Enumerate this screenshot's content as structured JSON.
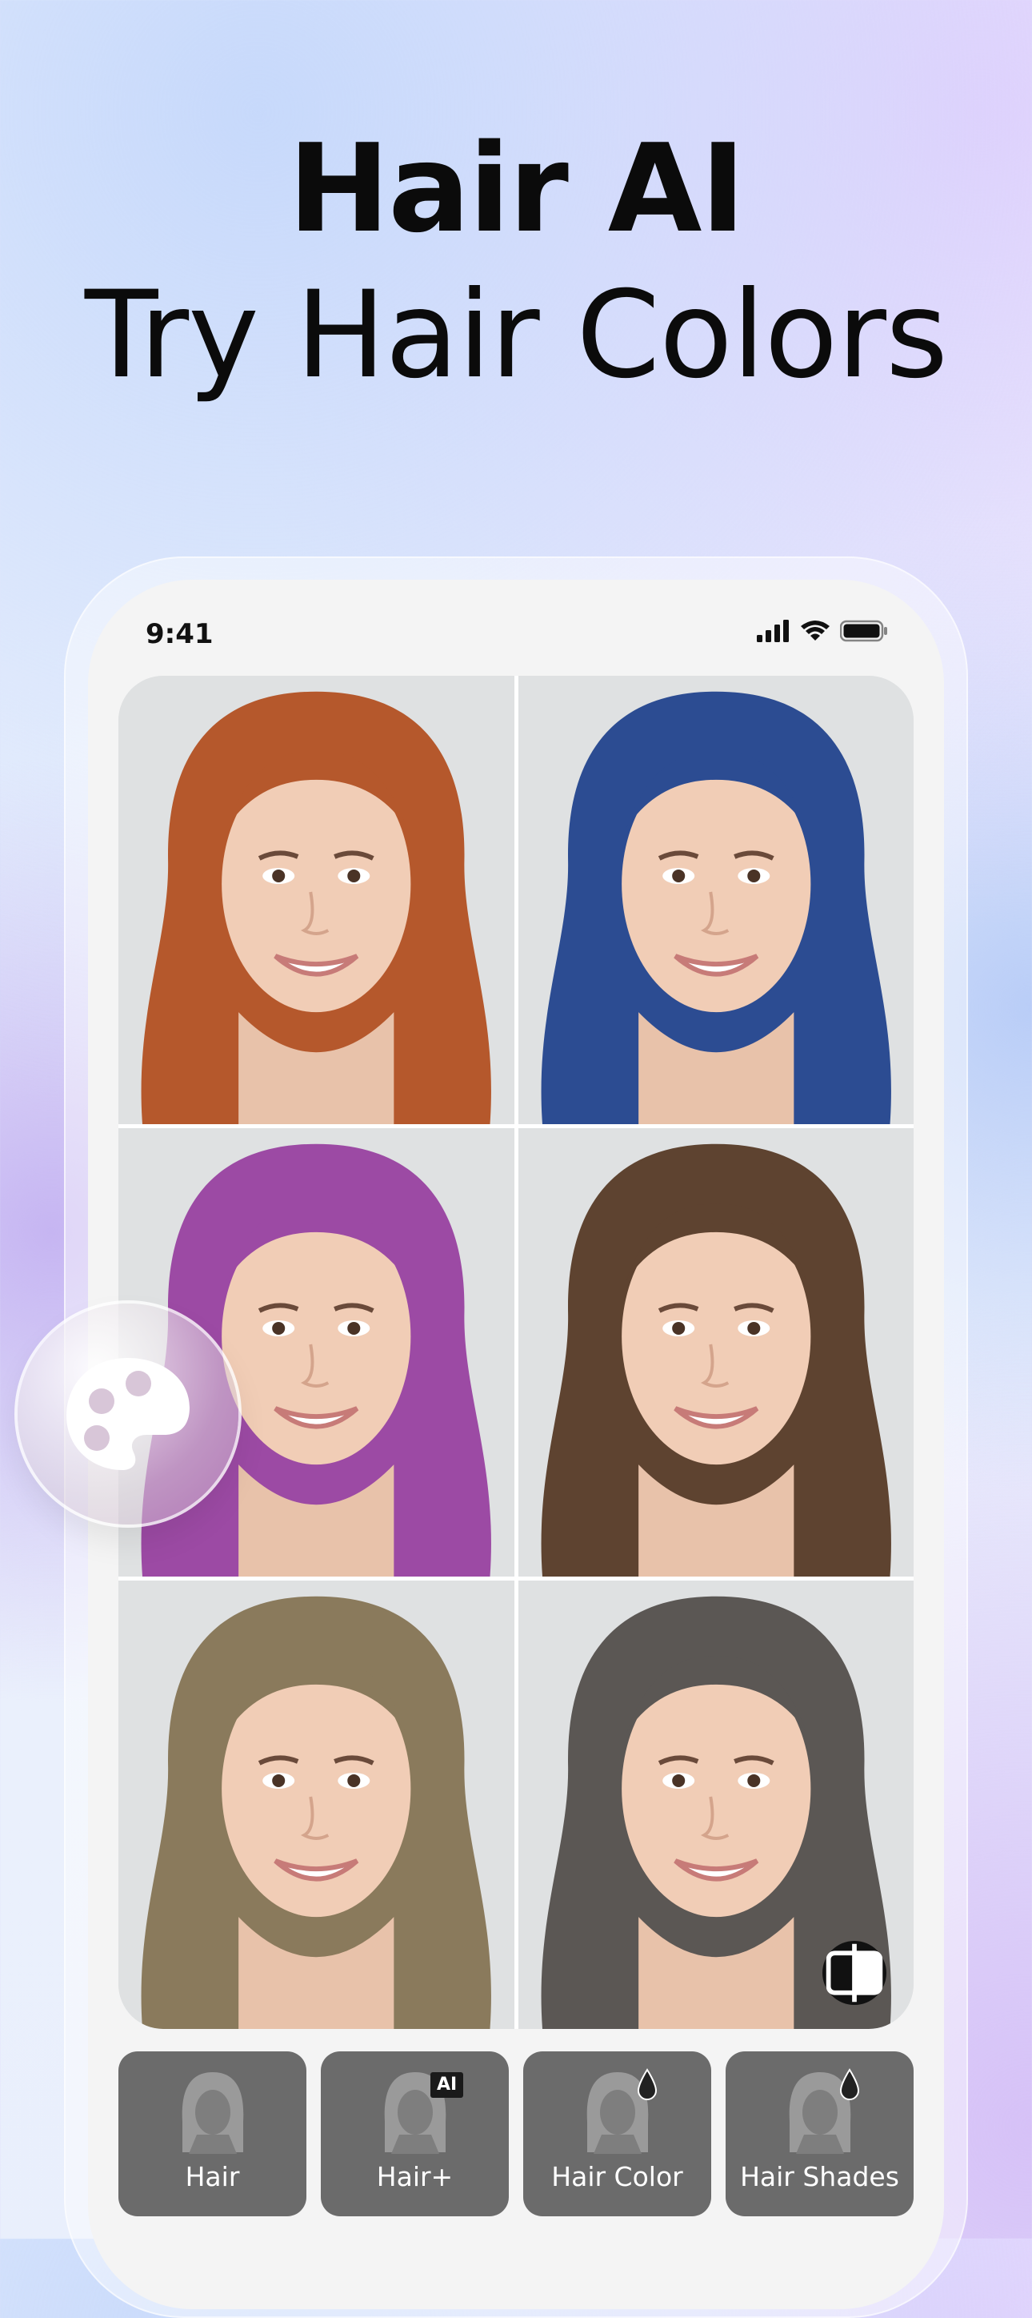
{
  "headline": {
    "title": "Hair AI",
    "subtitle": "Try Hair Colors"
  },
  "status_bar": {
    "time": "9:41"
  },
  "photo_grid": {
    "hair_colors": [
      "#b5582c",
      "#2c4c92",
      "#9c4aa4",
      "#5e4330",
      "#8a7a5c",
      "#5b5754"
    ]
  },
  "tabs": [
    {
      "label": "Hair",
      "badge": ""
    },
    {
      "label": "Hair+",
      "badge": "AI"
    },
    {
      "label": "Hair Color",
      "badge": "drop-icon"
    },
    {
      "label": "Hair Shades",
      "badge": "drop-icon"
    }
  ],
  "icons": {
    "palette": "palette-icon",
    "compare": "compare-icon"
  }
}
